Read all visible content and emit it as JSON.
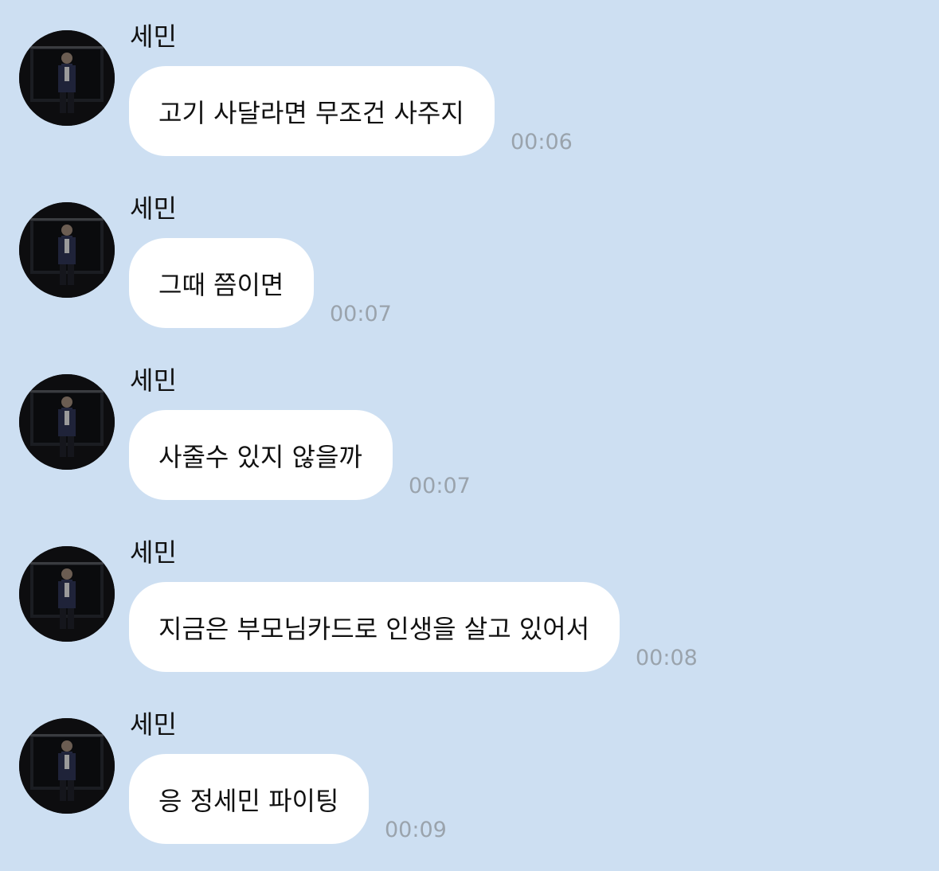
{
  "theme": {
    "background": "#cddff2",
    "bubble_color": "#ffffff",
    "timestamp_color": "#9aa3ac"
  },
  "messages": [
    {
      "sender": "세민",
      "text": "고기 사달라면 무조건 사주지",
      "time": "00:06"
    },
    {
      "sender": "세민",
      "text": "그때 쯤이면",
      "time": "00:07"
    },
    {
      "sender": "세민",
      "text": "사줄수 있지 않을까",
      "time": "00:07"
    },
    {
      "sender": "세민",
      "text": "지금은 부모님카드로 인생을 살고 있어서",
      "time": "00:08"
    },
    {
      "sender": "세민",
      "text": "응 정세민 파이팅",
      "time": "00:09"
    }
  ]
}
